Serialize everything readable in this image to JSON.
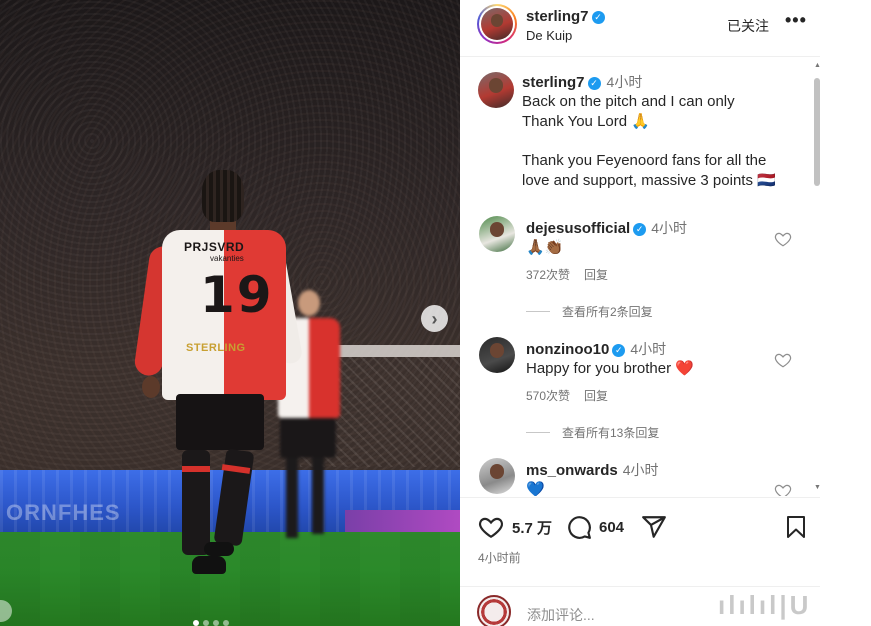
{
  "photo": {
    "jersey_sponsor": "PRJSVRD",
    "jersey_sponsor_sub": "vakanties",
    "jersey_number": "19",
    "jersey_name": "STERLING",
    "board_text": "ORNFHES",
    "next_arrow": "›"
  },
  "post": {
    "username": "sterling7",
    "location": "De Kuip",
    "follow_status": "已关注",
    "more": "•••",
    "caption": {
      "username": "sterling7",
      "time": "4小时",
      "line1": "Back on the pitch and I can only",
      "line2": "Thank You Lord 🙏",
      "line3": "Thank you Feyenoord fans for all the",
      "line4": "love and support, massive 3 points 🇳🇱"
    },
    "comments": [
      {
        "username": "dejesusofficial",
        "verified": true,
        "time": "4小时",
        "text": "🙏🏾👏🏾",
        "likes": "372次赞",
        "reply": "回复",
        "view_replies": "查看所有2条回复"
      },
      {
        "username": "nonzinoo10",
        "verified": true,
        "time": "4小时",
        "text": "Happy for you brother ❤️",
        "likes": "570次赞",
        "reply": "回复",
        "view_replies": "查看所有13条回复"
      },
      {
        "username": "ms_onwards",
        "verified": false,
        "time": "4小时",
        "text": "💙"
      }
    ],
    "like_count": "5.7 万",
    "comment_count": "604",
    "time_ago": "4小时前",
    "add_comment_placeholder": "添加评论...",
    "colors": {
      "verified": "#1d9bf0",
      "muted_text": "#737373",
      "heart_red": "#ed4956"
    }
  },
  "watermark": "ılılıl|U"
}
